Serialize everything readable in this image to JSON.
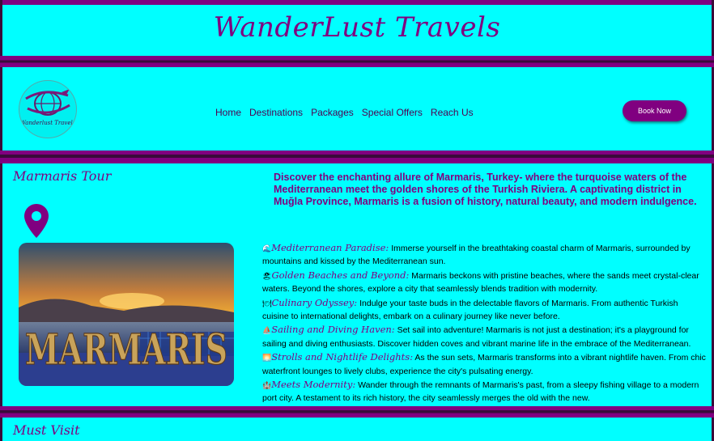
{
  "header": {
    "title": "WanderLust Travels"
  },
  "logo": {
    "text": "Wanderlust Travels"
  },
  "nav": {
    "items": [
      "Home",
      "Destinations",
      "Packages",
      "Special Offers",
      "Reach Us"
    ]
  },
  "cta": {
    "book_label": "Book Now"
  },
  "tour": {
    "title": "Marmaris Tour",
    "photo_sign": "MARMARIS",
    "intro": "Discover the enchanting allure of Marmaris, Turkey- where the turquoise waters of the Mediterranean meet the golden shores of the Turkish Riviera. A captivating district in Muğla Province, Marmaris is a fusion of history, natural beauty, and modern indulgence.",
    "features": [
      {
        "emoji": "🌊",
        "title": "Mediterranean Paradise:",
        "text": " Immerse yourself in the breathtaking coastal charm of Marmaris, surrounded by mountains and kissed by the Mediterranean sun."
      },
      {
        "emoji": "🏖",
        "title": "Golden Beaches and Beyond:",
        "text": " Marmaris beckons with pristine beaches, where the sands meet crystal-clear waters. Beyond the shores, explore a city that seamlessly blends tradition with modernity."
      },
      {
        "emoji": "🍽",
        "title": "Culinary Odyssey:",
        "text": " Indulge your taste buds in the delectable flavors of Marmaris. From authentic Turkish cuisine to international delights, embark on a culinary journey like never before."
      },
      {
        "emoji": "⛵",
        "title": "Sailing and Diving Haven:",
        "text": " Set sail into adventure! Marmaris is not just a destination; it's a playground for sailing and diving enthusiasts. Discover hidden coves and vibrant marine life in the embrace of the Mediterranean."
      },
      {
        "emoji": "🌅",
        "title": "Strolls and Nightlife Delights:",
        "text": " As the sun sets, Marmaris transforms into a vibrant nightlife haven. From chic waterfront lounges to lively clubs, experience the city's pulsating energy."
      },
      {
        "emoji": "🏰",
        "title": "Meets Modernity:",
        "text": " Wander through the remnants of Marmaris's past, from a sleepy fishing village to a modern port city. A testament to its rich history, the city seamlessly merges the old with the new."
      }
    ]
  },
  "must_visit": {
    "title": "Must Visit"
  }
}
